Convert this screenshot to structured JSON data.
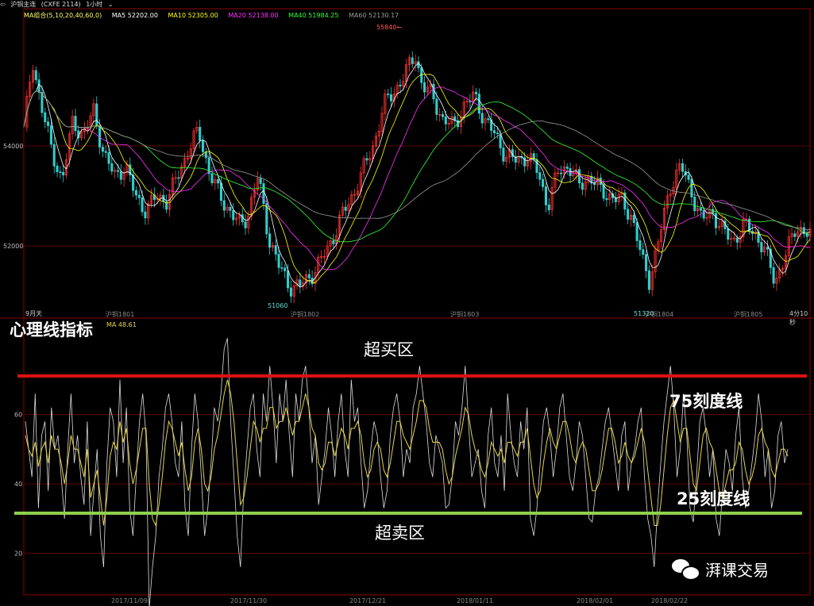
{
  "toolbar": {
    "title": "沪铜主连",
    "code": "(CXFE 2114)",
    "period": "1小时"
  },
  "ma_legend": {
    "group": "MA组合(5,10,20,40,60,0)",
    "items": [
      {
        "label": "MA5 52202.00",
        "color": "#ffffff"
      },
      {
        "label": "MA10 52305.00",
        "color": "#ffff00"
      },
      {
        "label": "MA20 52138.00",
        "color": "#ff33ff"
      },
      {
        "label": "MA40 51984.25",
        "color": "#33ff33"
      },
      {
        "label": "MA60 52130.17",
        "color": "#999999"
      }
    ]
  },
  "price_marks": {
    "high": "55840",
    "low": "51060",
    "low2": "51320"
  },
  "contract_labels": [
    "沪铜1801",
    "沪铜1802",
    "沪铜1803",
    "沪铜1804",
    "沪铜1805"
  ],
  "misc_labels": {
    "left": "9月天",
    "right": "4分10秒"
  },
  "sub_legend": "MA 48.61",
  "annotations": {
    "indicator_title": "心理线指标",
    "overbought": "超买区",
    "oversold": "超卖区",
    "line75": "75刻度线",
    "line25": "25刻度线"
  },
  "watermark": "湃课交易",
  "colors": {
    "red_line": "#dd1111",
    "green_line": "#8fd14f",
    "grid": "#5a0000",
    "axis": "#8b0000",
    "up": "#ff3333",
    "down": "#33cccc",
    "psy": "#dddddd",
    "psy_ma": "#e8d44a"
  },
  "chart_data": [
    {
      "type": "candlestick",
      "title": "沪铜主连",
      "y_ticks": [
        52000,
        54000
      ],
      "ylim": [
        50800,
        56500
      ],
      "high": 55840,
      "low": 51060,
      "close_path": [
        [
          0,
          54300
        ],
        [
          5,
          55700
        ],
        [
          10,
          54800
        ],
        [
          16,
          53900
        ],
        [
          22,
          53300
        ],
        [
          28,
          54500
        ],
        [
          34,
          54200
        ],
        [
          40,
          54700
        ],
        [
          46,
          53800
        ],
        [
          52,
          53400
        ],
        [
          58,
          53600
        ],
        [
          64,
          53000
        ],
        [
          70,
          52700
        ],
        [
          76,
          53000
        ],
        [
          82,
          52900
        ],
        [
          88,
          53400
        ],
        [
          94,
          53900
        ],
        [
          100,
          54300
        ],
        [
          106,
          53500
        ],
        [
          112,
          53000
        ],
        [
          118,
          52700
        ],
        [
          124,
          52400
        ],
        [
          128,
          52600
        ],
        [
          134,
          53400
        ],
        [
          140,
          52200
        ],
        [
          146,
          51600
        ],
        [
          152,
          51200
        ],
        [
          158,
          51200
        ],
        [
          164,
          51400
        ],
        [
          170,
          51700
        ],
        [
          176,
          52100
        ],
        [
          182,
          52600
        ],
        [
          188,
          53000
        ],
        [
          194,
          53500
        ],
        [
          200,
          54000
        ],
        [
          206,
          54800
        ],
        [
          212,
          55100
        ],
        [
          218,
          55400
        ],
        [
          224,
          55840
        ],
        [
          228,
          55200
        ],
        [
          234,
          55000
        ],
        [
          240,
          54500
        ],
        [
          246,
          54400
        ],
        [
          252,
          54800
        ],
        [
          258,
          55000
        ],
        [
          264,
          54500
        ],
        [
          270,
          54200
        ],
        [
          276,
          53800
        ],
        [
          282,
          53700
        ],
        [
          288,
          53800
        ],
        [
          294,
          53500
        ],
        [
          300,
          52800
        ],
        [
          306,
          53500
        ],
        [
          312,
          53600
        ],
        [
          318,
          53200
        ],
        [
          324,
          53400
        ],
        [
          330,
          53100
        ],
        [
          336,
          53000
        ],
        [
          342,
          52900
        ],
        [
          348,
          52600
        ],
        [
          354,
          51700
        ],
        [
          358,
          51320
        ],
        [
          364,
          52200
        ],
        [
          370,
          53200
        ],
        [
          376,
          53600
        ],
        [
          382,
          53100
        ],
        [
          388,
          52500
        ],
        [
          394,
          52700
        ],
        [
          400,
          52300
        ],
        [
          406,
          52100
        ],
        [
          412,
          52400
        ],
        [
          418,
          52300
        ],
        [
          424,
          51900
        ],
        [
          430,
          51300
        ],
        [
          436,
          51800
        ],
        [
          442,
          52400
        ],
        [
          446,
          52300
        ],
        [
          450,
          52200
        ]
      ]
    },
    {
      "type": "line",
      "title": "心理线指标",
      "y_ticks": [
        20,
        40,
        60
      ],
      "ylim": [
        8,
        88
      ],
      "reference_lines": [
        75,
        25
      ],
      "series": [
        {
          "name": "PSY",
          "values": [
            58,
            50,
            42,
            66,
            33,
            54,
            58,
            38,
            62,
            50,
            54,
            42,
            30,
            50,
            66,
            46,
            54,
            42,
            34,
            58,
            25,
            38,
            50,
            25,
            16,
            46,
            62,
            58,
            42,
            70,
            46,
            62,
            33,
            25,
            42,
            58,
            66,
            54,
            4,
            16,
            25,
            42,
            50,
            62,
            66,
            58,
            46,
            42,
            58,
            33,
            25,
            50,
            66,
            58,
            42,
            25,
            33,
            46,
            62,
            58,
            66,
            79,
            82,
            58,
            42,
            25,
            16,
            38,
            50,
            62,
            66,
            50,
            42,
            66,
            58,
            74,
            62,
            46,
            66,
            58,
            70,
            54,
            42,
            66,
            58,
            70,
            74,
            62,
            46,
            54,
            34,
            42,
            50,
            62,
            54,
            42,
            58,
            66,
            50,
            42,
            70,
            58,
            62,
            46,
            33,
            38,
            50,
            58,
            54,
            42,
            33,
            38,
            54,
            62,
            66,
            58,
            42,
            50,
            46,
            62,
            66,
            74,
            66,
            58,
            46,
            42,
            54,
            50,
            46,
            33,
            34,
            42,
            58,
            54,
            62,
            74,
            58,
            42,
            46,
            50,
            38,
            33,
            54,
            62,
            46,
            42,
            54,
            38,
            66,
            54,
            46,
            42,
            58,
            50,
            62,
            30,
            25,
            33,
            46,
            58,
            62,
            54,
            42,
            50,
            62,
            66,
            54,
            42,
            38,
            46,
            58,
            54,
            42,
            30,
            29,
            38,
            42,
            50,
            58,
            62,
            54,
            46,
            38,
            54,
            58,
            38,
            46,
            50,
            58,
            62,
            42,
            30,
            25,
            16,
            33,
            46,
            58,
            66,
            74,
            62,
            42,
            50,
            66,
            54,
            33,
            29,
            42,
            58,
            62,
            54,
            42,
            50,
            30,
            25,
            38,
            50,
            46,
            38,
            54,
            62,
            42,
            33,
            38,
            46,
            54,
            66,
            58,
            42,
            50,
            33,
            38,
            54,
            58,
            46,
            50
          ]
        },
        {
          "name": "MA",
          "values": [
            54,
            50,
            48,
            52,
            45,
            50,
            52,
            46,
            54,
            50,
            50,
            46,
            40,
            46,
            54,
            50,
            50,
            46,
            42,
            50,
            36,
            40,
            44,
            36,
            28,
            36,
            48,
            52,
            50,
            58,
            52,
            56,
            46,
            40,
            44,
            50,
            56,
            56,
            40,
            30,
            28,
            34,
            42,
            52,
            58,
            56,
            52,
            48,
            52,
            44,
            38,
            42,
            52,
            56,
            50,
            40,
            38,
            42,
            50,
            54,
            60,
            66,
            70,
            66,
            58,
            46,
            34,
            36,
            42,
            50,
            58,
            56,
            52,
            56,
            56,
            62,
            62,
            56,
            58,
            58,
            62,
            58,
            54,
            58,
            58,
            62,
            66,
            62,
            56,
            54,
            46,
            44,
            46,
            52,
            52,
            48,
            52,
            56,
            54,
            50,
            56,
            56,
            58,
            54,
            46,
            42,
            44,
            50,
            52,
            50,
            44,
            42,
            46,
            52,
            58,
            58,
            54,
            52,
            50,
            54,
            58,
            64,
            64,
            62,
            56,
            52,
            52,
            52,
            50,
            44,
            40,
            42,
            48,
            52,
            56,
            62,
            60,
            54,
            50,
            48,
            44,
            42,
            46,
            52,
            50,
            48,
            50,
            46,
            52,
            52,
            50,
            48,
            52,
            52,
            56,
            48,
            40,
            36,
            38,
            46,
            52,
            56,
            52,
            50,
            54,
            58,
            58,
            54,
            48,
            46,
            50,
            52,
            50,
            44,
            38,
            38,
            40,
            44,
            50,
            56,
            56,
            52,
            46,
            48,
            52,
            48,
            46,
            48,
            52,
            56,
            52,
            44,
            36,
            28,
            28,
            34,
            44,
            54,
            62,
            64,
            58,
            52,
            56,
            56,
            48,
            40,
            38,
            46,
            54,
            56,
            52,
            50,
            44,
            38,
            36,
            40,
            44,
            44,
            46,
            52,
            50,
            44,
            40,
            42,
            46,
            54,
            56,
            52,
            50,
            44,
            42,
            46,
            50,
            50,
            48
          ]
        }
      ]
    }
  ]
}
